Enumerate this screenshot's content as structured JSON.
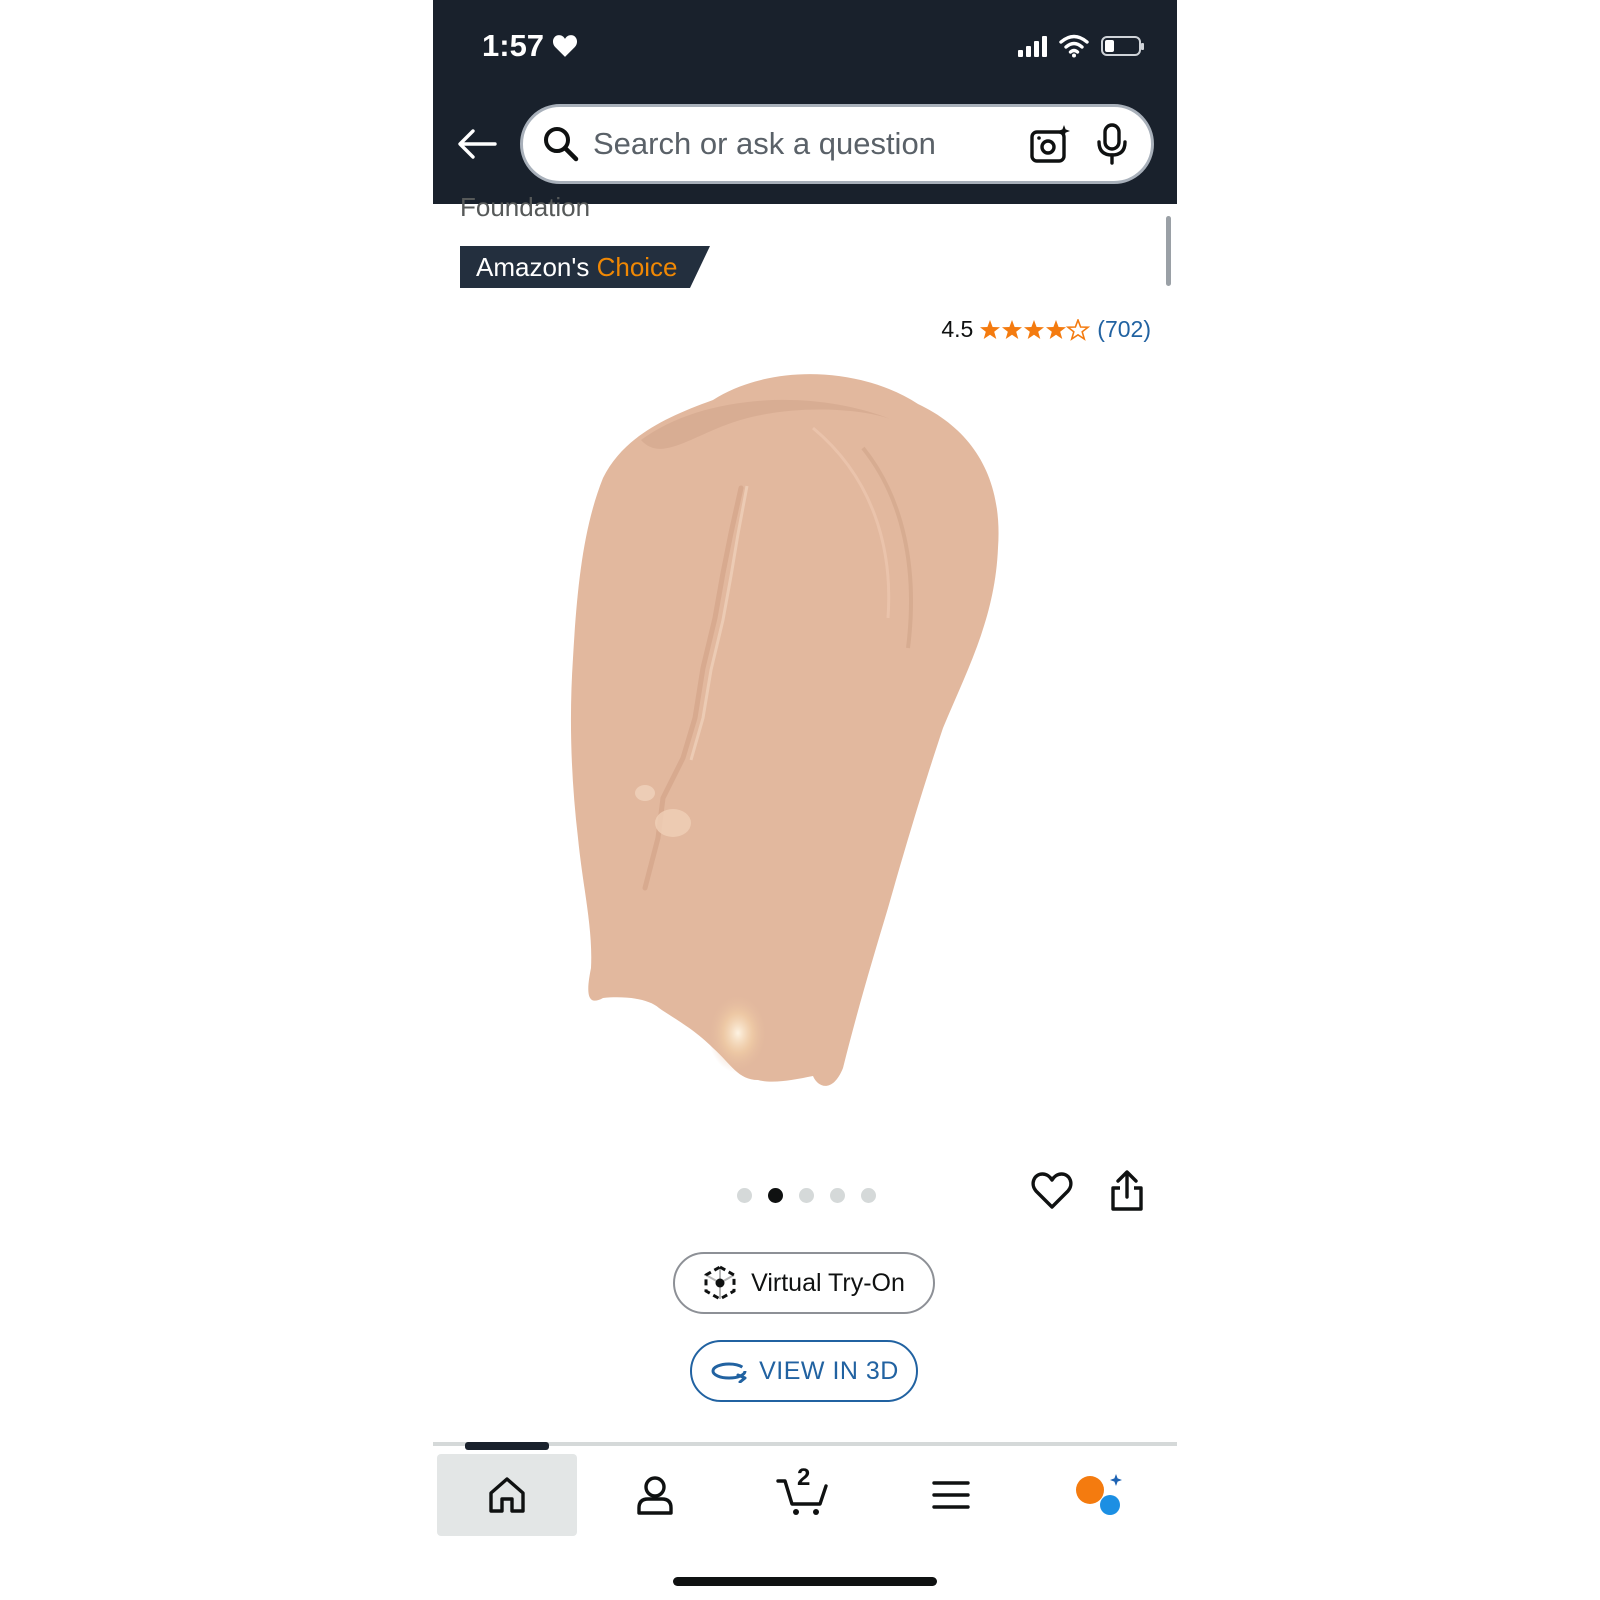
{
  "status_bar": {
    "time": "1:57"
  },
  "search": {
    "placeholder": "Search or ask a question"
  },
  "product": {
    "title_partial": "Foundation",
    "badge": {
      "prefix": "Amazon's",
      "highlight": "Choice"
    },
    "rating": {
      "value": "4.5",
      "stars": 4.5,
      "count": "(702)"
    },
    "image_carousel": {
      "total": 5,
      "active_index": 1
    },
    "buttons": {
      "virtual_try_on": "Virtual Try-On",
      "view_3d": "VIEW IN 3D"
    }
  },
  "bottom_nav": {
    "cart_count": "2",
    "active": "home"
  },
  "colors": {
    "header_bg": "#19212c",
    "badge_bg": "#232f3e",
    "badge_highlight": "#f08804",
    "star": "#f47b0f",
    "link": "#2162a1",
    "swatch": "#e2b89e"
  }
}
